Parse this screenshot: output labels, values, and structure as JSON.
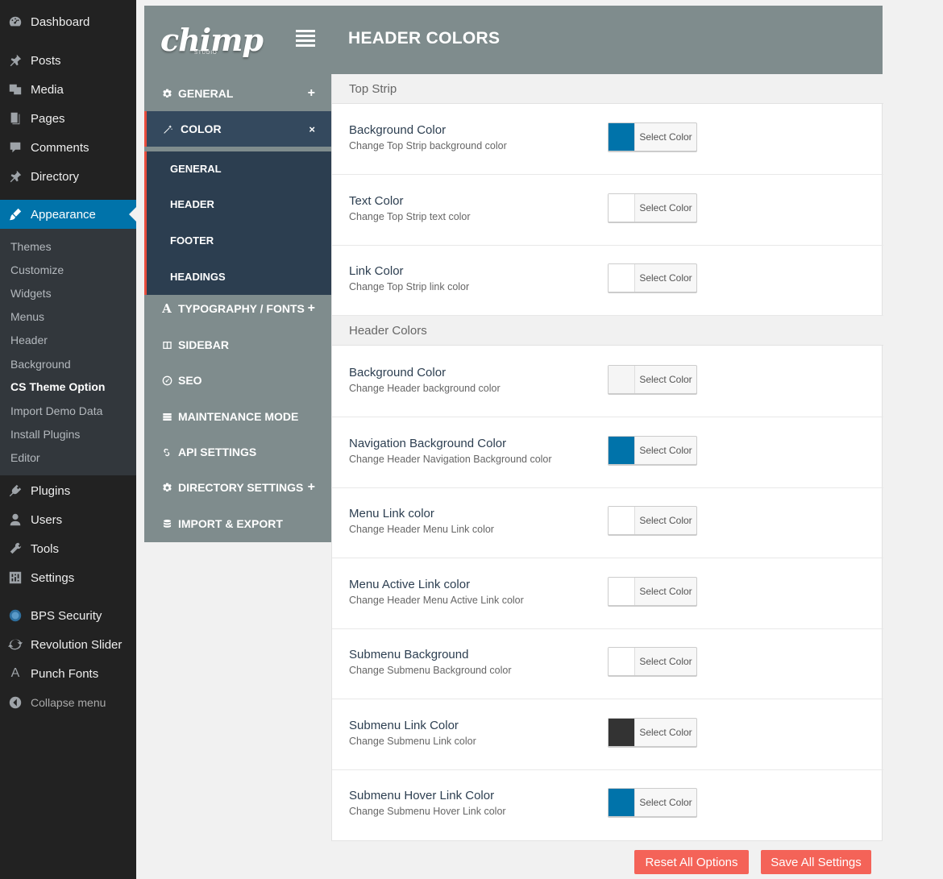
{
  "wp_menu": {
    "items": [
      {
        "label": "Dashboard",
        "icon": "dashboard-icon"
      },
      {
        "label": "Posts",
        "icon": "pin-icon"
      },
      {
        "label": "Media",
        "icon": "media-icon"
      },
      {
        "label": "Pages",
        "icon": "pages-icon"
      },
      {
        "label": "Comments",
        "icon": "comment-icon"
      },
      {
        "label": "Directory",
        "icon": "pin-icon"
      },
      {
        "label": "Appearance",
        "icon": "paintbrush-icon"
      },
      {
        "label": "Plugins",
        "icon": "plug-icon"
      },
      {
        "label": "Users",
        "icon": "user-icon"
      },
      {
        "label": "Tools",
        "icon": "wrench-icon"
      },
      {
        "label": "Settings",
        "icon": "settings-icon"
      },
      {
        "label": "BPS Security",
        "icon": "shield-icon"
      },
      {
        "label": "Revolution Slider",
        "icon": "refresh-icon"
      },
      {
        "label": "Punch Fonts",
        "icon": "font-icon"
      },
      {
        "label": "Collapse menu",
        "icon": "collapse-icon"
      }
    ],
    "appearance_sub": [
      "Themes",
      "Customize",
      "Widgets",
      "Menus",
      "Header",
      "Background",
      "CS Theme Option",
      "Import Demo Data",
      "Install Plugins",
      "Editor"
    ]
  },
  "panel": {
    "logo_text": "chimp",
    "logo_sub": "STUDIO",
    "title": "HEADER COLORS",
    "nav": [
      {
        "label": "GENERAL",
        "plus": "+"
      },
      {
        "label": "COLOR",
        "plus": "×"
      },
      {
        "label": "TYPOGRAPHY / FONTS",
        "plus": "+"
      },
      {
        "label": "SIDEBAR",
        "plus": ""
      },
      {
        "label": "SEO",
        "plus": ""
      },
      {
        "label": "MAINTENANCE MODE",
        "plus": ""
      },
      {
        "label": "API SETTINGS",
        "plus": ""
      },
      {
        "label": "DIRECTORY SETTINGS",
        "plus": "+"
      },
      {
        "label": "IMPORT & EXPORT",
        "plus": ""
      }
    ],
    "color_sub": [
      "GENERAL",
      "HEADER",
      "FOOTER",
      "HEADINGS"
    ]
  },
  "content": {
    "sections": [
      "Top Strip",
      "Header Colors"
    ],
    "select_label": "Select Color",
    "options": [
      {
        "label": "Background Color",
        "desc": "Change Top Strip background color",
        "color": "#0073aa"
      },
      {
        "label": "Text Color",
        "desc": "Change Top Strip text color",
        "color": "#ffffff"
      },
      {
        "label": "Link Color",
        "desc": "Change Top Strip link color",
        "color": "#ffffff"
      },
      {
        "label": "Background Color",
        "desc": "Change Header background color",
        "color": "#f5f5f5"
      },
      {
        "label": "Navigation Background Color",
        "desc": "Change Header Navigation Background color",
        "color": "#0073aa"
      },
      {
        "label": "Menu Link color",
        "desc": "Change Header Menu Link color",
        "color": "#ffffff"
      },
      {
        "label": "Menu Active Link color",
        "desc": "Change Header Menu Active Link color",
        "color": "#ffffff"
      },
      {
        "label": "Submenu Background",
        "desc": "Change Submenu Background color",
        "color": "#ffffff"
      },
      {
        "label": "Submenu Link Color",
        "desc": "Change Submenu Link color",
        "color": "#333333"
      },
      {
        "label": "Submenu Hover Link Color",
        "desc": "Change Submenu Hover Link color",
        "color": "#0073aa"
      }
    ]
  },
  "footer": {
    "reset_label": "Reset All Options",
    "save_label": "Save All Settings"
  }
}
